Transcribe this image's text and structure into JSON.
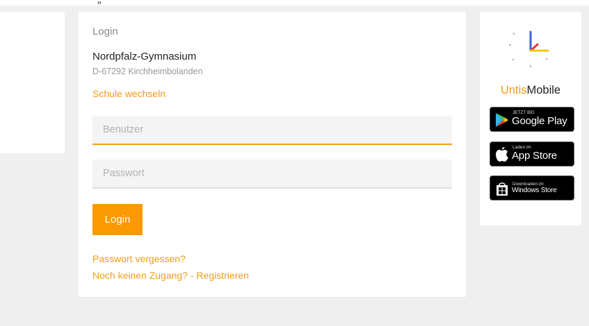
{
  "top_strip": {
    "text": "„"
  },
  "login": {
    "title": "Login",
    "school_name": "Nordpfalz-Gymnasium",
    "school_address": "D-67292 Kirchheimbolanden",
    "switch_school": "Schule wechseln",
    "username_placeholder": "Benutzer",
    "password_placeholder": "Passwort",
    "login_button": "Login",
    "forgot_password": "Passwort vergessen?",
    "register": "Noch keinen Zugang? - Registrieren"
  },
  "side": {
    "brand_part1": "Untis",
    "brand_part2": "Mobile",
    "google": {
      "small": "JETZT BEI",
      "big": "Google Play",
      "icon": "google-play-icon"
    },
    "apple": {
      "small": "Laden im",
      "big": "App Store",
      "icon": "apple-icon"
    },
    "windows": {
      "small": "Downloaden im",
      "big": "Windows Store",
      "icon": "windows-store-icon"
    }
  },
  "colors": {
    "accent": "#f49b1a",
    "button": "#fb9a00",
    "background": "#efefef",
    "logo_blue": "#3b62d6",
    "logo_red": "#e8392c",
    "logo_yellow": "#f7c500"
  }
}
